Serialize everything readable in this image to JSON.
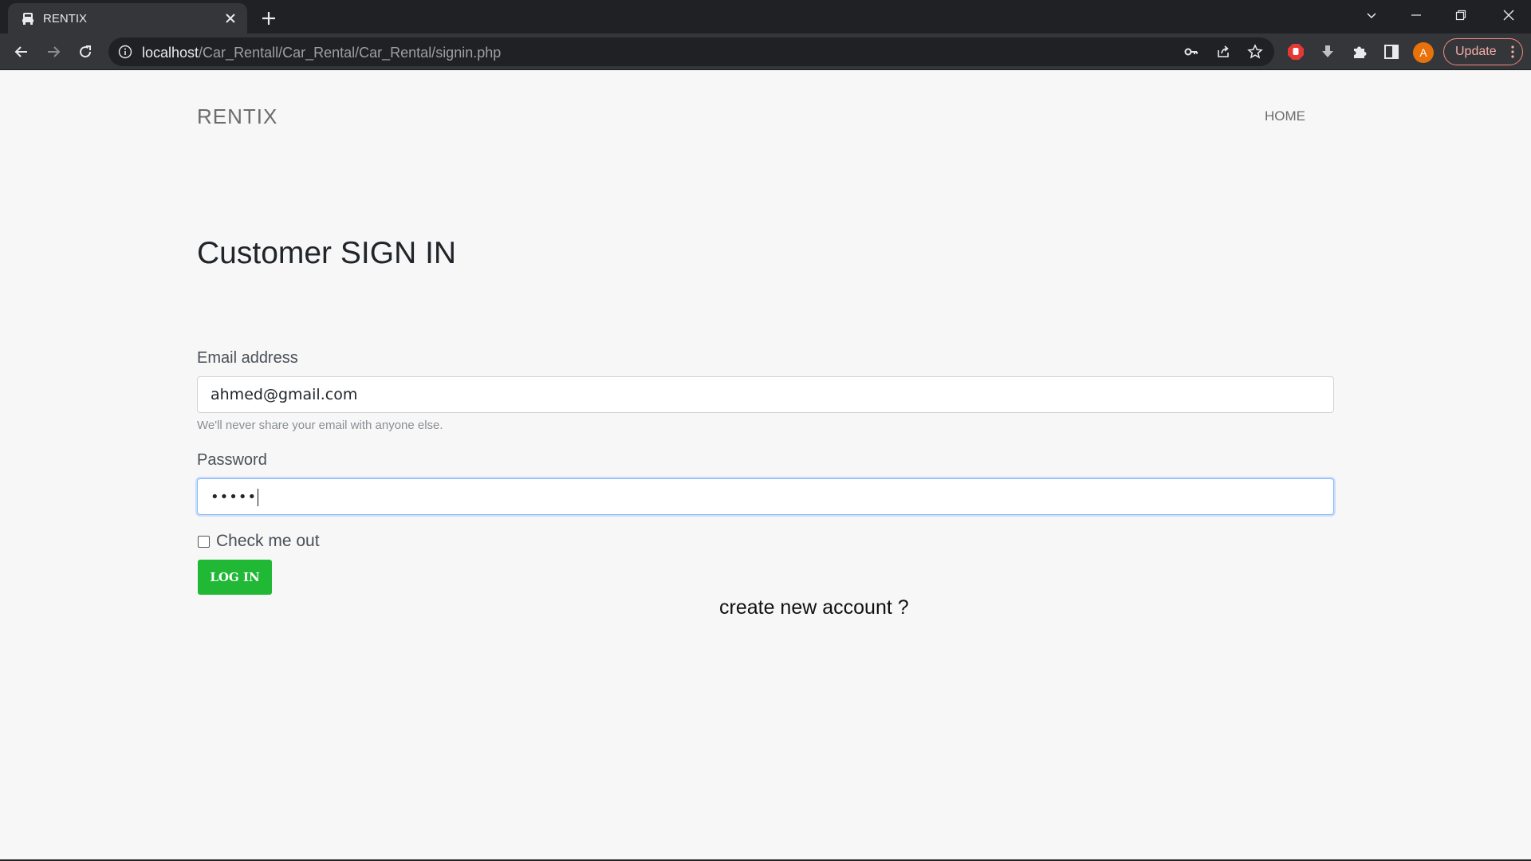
{
  "browser": {
    "tab_title": "RENTIX",
    "url_host": "localhost",
    "url_path": "/Car_Rentall/Car_Rental/Car_Rental/signin.php",
    "avatar_letter": "A",
    "update_label": "Update"
  },
  "site": {
    "brand": "RENTIX",
    "nav_home": "HOME"
  },
  "form": {
    "title": "Customer SIGN IN",
    "email_label": "Email address",
    "email_value": "ahmed@gmail.com",
    "email_help": "We'll never share your email with anyone else.",
    "password_label": "Password",
    "password_masked": "•••••",
    "checkbox_label": "Check me out",
    "login_label": "LOG IN",
    "create_account": "create new account ?"
  },
  "colors": {
    "login_button": "#20b835",
    "page_background": "#f7f7f7",
    "focus_border": "#86b7fe"
  }
}
